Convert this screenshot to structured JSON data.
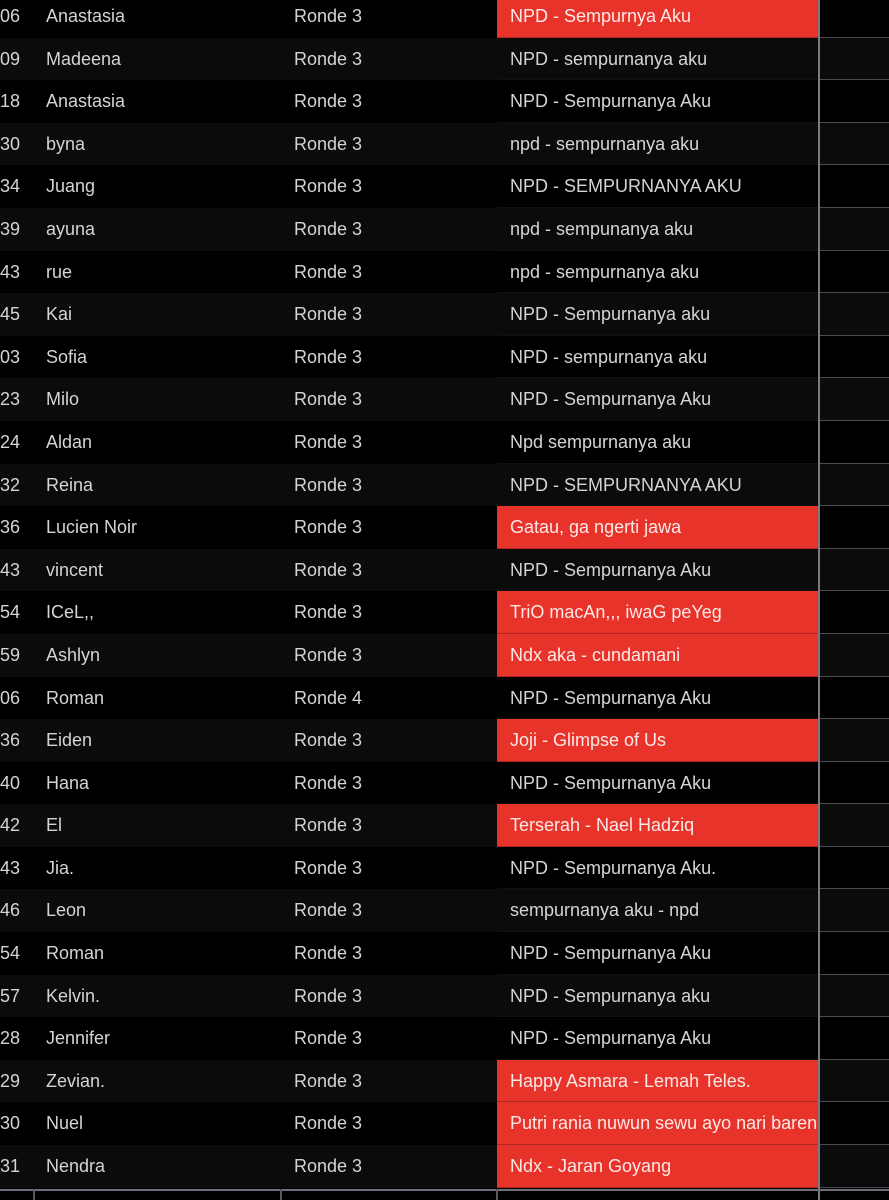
{
  "sheet": {
    "highlight_color": "#e8332b",
    "rows": [
      {
        "num": "06",
        "name": "Anastasia",
        "round": "Ronde 3",
        "song": "NPD - Sempurnya Aku",
        "highlight": true
      },
      {
        "num": "09",
        "name": "Madeena",
        "round": "Ronde 3",
        "song": "NPD - sempurnanya aku",
        "highlight": false
      },
      {
        "num": "18",
        "name": "Anastasia",
        "round": "Ronde 3",
        "song": "NPD - Sempurnanya Aku",
        "highlight": false
      },
      {
        "num": "30",
        "name": "byna",
        "round": "Ronde 3",
        "song": "npd - sempurnanya aku",
        "highlight": false
      },
      {
        "num": "34",
        "name": "Juang",
        "round": "Ronde 3",
        "song": "NPD - SEMPURNANYA AKU",
        "highlight": false
      },
      {
        "num": "39",
        "name": "ayuna",
        "round": "Ronde 3",
        "song": "npd - sempunanya aku",
        "highlight": false
      },
      {
        "num": "43",
        "name": "rue",
        "round": "Ronde 3",
        "song": "npd - sempurnanya aku",
        "highlight": false
      },
      {
        "num": "45",
        "name": "Kai",
        "round": "Ronde 3",
        "song": "NPD - Sempurnanya aku",
        "highlight": false
      },
      {
        "num": "03",
        "name": "Sofia",
        "round": "Ronde 3",
        "song": "NPD - sempurnanya aku",
        "highlight": false
      },
      {
        "num": "23",
        "name": "Milo",
        "round": "Ronde 3",
        "song": "NPD - Sempurnanya Aku",
        "highlight": false
      },
      {
        "num": "24",
        "name": "Aldan",
        "round": "Ronde 3",
        "song": "Npd sempurnanya aku",
        "highlight": false
      },
      {
        "num": "32",
        "name": "Reina",
        "round": "Ronde 3",
        "song": "NPD - SEMPURNANYA AKU",
        "highlight": false
      },
      {
        "num": "36",
        "name": "Lucien Noir",
        "round": "Ronde 3",
        "song": "Gatau, ga ngerti jawa",
        "highlight": true
      },
      {
        "num": "43",
        "name": "vincent",
        "round": "Ronde 3",
        "song": "NPD - Sempurnanya Aku",
        "highlight": false
      },
      {
        "num": "54",
        "name": "ICeL,,",
        "round": "Ronde 3",
        "song": "TriO macAn,,, iwaG peYeg",
        "highlight": true
      },
      {
        "num": "59",
        "name": "Ashlyn",
        "round": "Ronde 3",
        "song": "Ndx aka - cundamani",
        "highlight": true
      },
      {
        "num": "06",
        "name": "Roman",
        "round": "Ronde 4",
        "song": "NPD - Sempurnanya Aku",
        "highlight": false
      },
      {
        "num": "36",
        "name": "Eiden",
        "round": "Ronde 3",
        "song": "Joji - Glimpse of Us",
        "highlight": true
      },
      {
        "num": "40",
        "name": "Hana",
        "round": "Ronde 3",
        "song": "NPD - Sempurnanya Aku",
        "highlight": false
      },
      {
        "num": "42",
        "name": "El",
        "round": "Ronde 3",
        "song": "Terserah - Nael Hadziq",
        "highlight": true
      },
      {
        "num": "43",
        "name": "Jia.",
        "round": "Ronde 3",
        "song": "NPD - Sempurnanya Aku.",
        "highlight": false
      },
      {
        "num": "46",
        "name": "Leon",
        "round": "Ronde 3",
        "song": "sempurnanya aku - npd",
        "highlight": false
      },
      {
        "num": "54",
        "name": "Roman",
        "round": "Ronde 3",
        "song": "NPD - Sempurnanya Aku",
        "highlight": false
      },
      {
        "num": "57",
        "name": "Kelvin.",
        "round": "Ronde 3",
        "song": "NPD - Sempurnanya aku",
        "highlight": false
      },
      {
        "num": "28",
        "name": "Jennifer",
        "round": "Ronde 3",
        "song": "NPD - Sempurnanya Aku",
        "highlight": false
      },
      {
        "num": "29",
        "name": "Zevian.",
        "round": "Ronde 3",
        "song": "Happy Asmara - Lemah Teles.",
        "highlight": true
      },
      {
        "num": "30",
        "name": "Nuel",
        "round": "Ronde 3",
        "song": "Putri rania nuwun sewu ayo nari bareng",
        "highlight": true
      },
      {
        "num": "31",
        "name": "Nendra",
        "round": "Ronde 3",
        "song": "Ndx - Jaran Goyang",
        "highlight": true
      }
    ]
  }
}
